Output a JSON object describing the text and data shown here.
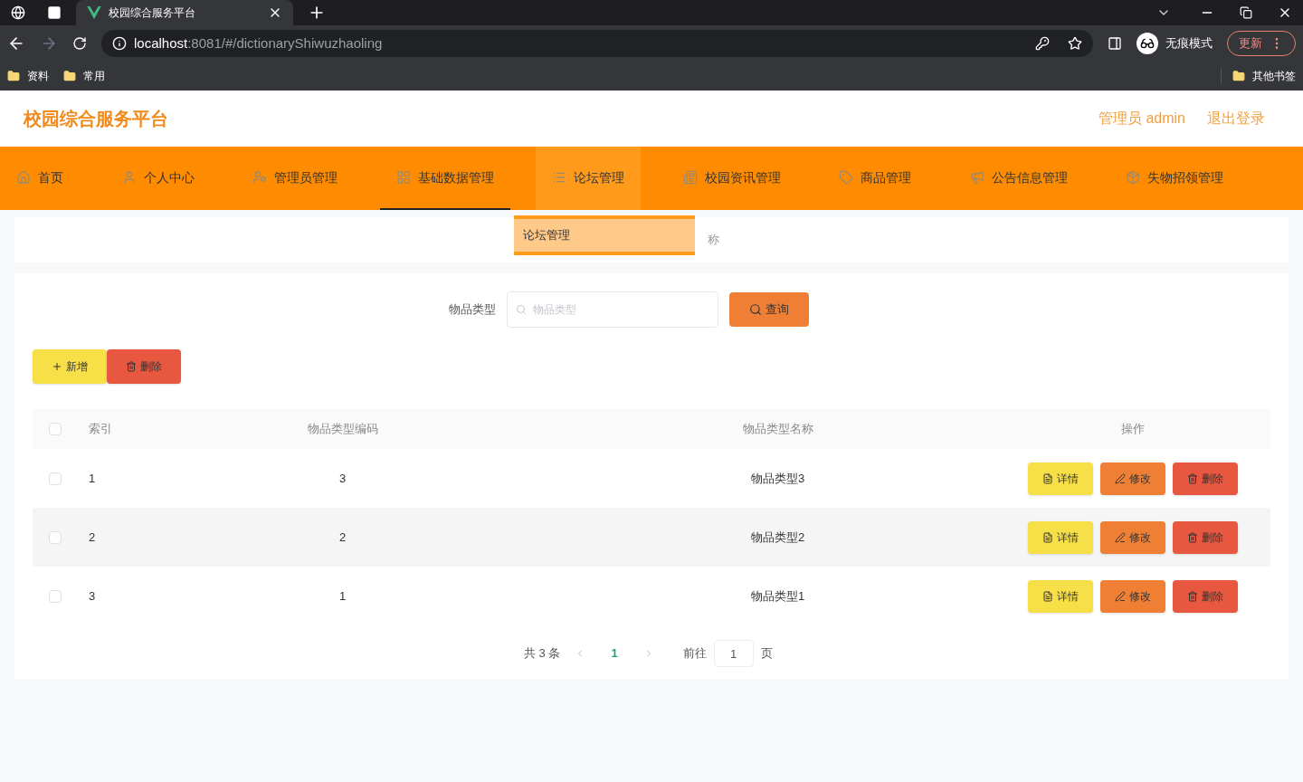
{
  "browser": {
    "tabs": [
      {
        "title": "校园综合服务平台",
        "selected": true
      }
    ],
    "url": {
      "host": "localhost",
      "path": ":8081/#/dictionaryShiwuzhaoling"
    },
    "profile": "无痕模式",
    "update_button": "更新",
    "bookmarks": [
      "资料",
      "常用"
    ],
    "other_bookmarks": "其他书签"
  },
  "header": {
    "title": "校园综合服务平台",
    "user": "管理员 admin",
    "logout": "退出登录"
  },
  "nav": {
    "items": [
      {
        "label": "首页",
        "kind": "home",
        "selected": false,
        "expanded": false
      },
      {
        "label": "个人中心",
        "kind": "user",
        "selected": false,
        "expanded": false
      },
      {
        "label": "管理员管理",
        "kind": "admin",
        "selected": false,
        "expanded": false
      },
      {
        "label": "基础数据管理",
        "kind": "grid",
        "selected": true,
        "expanded": false
      },
      {
        "label": "论坛管理",
        "kind": "list",
        "selected": false,
        "expanded": true,
        "children": [
          "论坛管理"
        ]
      },
      {
        "label": "校园资讯管理",
        "kind": "news",
        "selected": false,
        "expanded": false
      },
      {
        "label": "商品管理",
        "kind": "tag",
        "selected": false,
        "expanded": false
      },
      {
        "label": "公告信息管理",
        "kind": "notice",
        "selected": false,
        "expanded": false
      },
      {
        "label": "失物招领管理",
        "kind": "box",
        "selected": false,
        "expanded": false
      }
    ]
  },
  "breadcrumb": "称",
  "search": {
    "label": "物品类型",
    "placeholder": "物品类型",
    "button": "查询"
  },
  "actions": [
    {
      "kind": "add",
      "label": "新增"
    },
    {
      "kind": "delete",
      "label": "删除"
    }
  ],
  "table": {
    "all_checked": false,
    "columns": [
      "索引",
      "物品类型编码",
      "物品类型名称",
      "操作"
    ],
    "rows": [
      {
        "index": "1",
        "code": "3",
        "name": "物品类型3",
        "checked": false,
        "actions": [
          {
            "kind": "detail",
            "label": "详情"
          },
          {
            "kind": "edit",
            "label": "修改"
          },
          {
            "kind": "delete",
            "label": "删除"
          }
        ]
      },
      {
        "index": "2",
        "code": "2",
        "name": "物品类型2",
        "checked": false,
        "actions": [
          {
            "kind": "detail",
            "label": "详情"
          },
          {
            "kind": "edit",
            "label": "修改"
          },
          {
            "kind": "delete",
            "label": "删除"
          }
        ]
      },
      {
        "index": "3",
        "code": "1",
        "name": "物品类型1",
        "checked": false,
        "actions": [
          {
            "kind": "detail",
            "label": "详情"
          },
          {
            "kind": "edit",
            "label": "修改"
          },
          {
            "kind": "delete",
            "label": "删除"
          }
        ]
      }
    ]
  },
  "pagination": {
    "total": "共 3 条",
    "pages": [
      {
        "label": "1",
        "selected": true
      }
    ],
    "goto_label": "前往",
    "goto_value": "1",
    "suffix": "页"
  }
}
